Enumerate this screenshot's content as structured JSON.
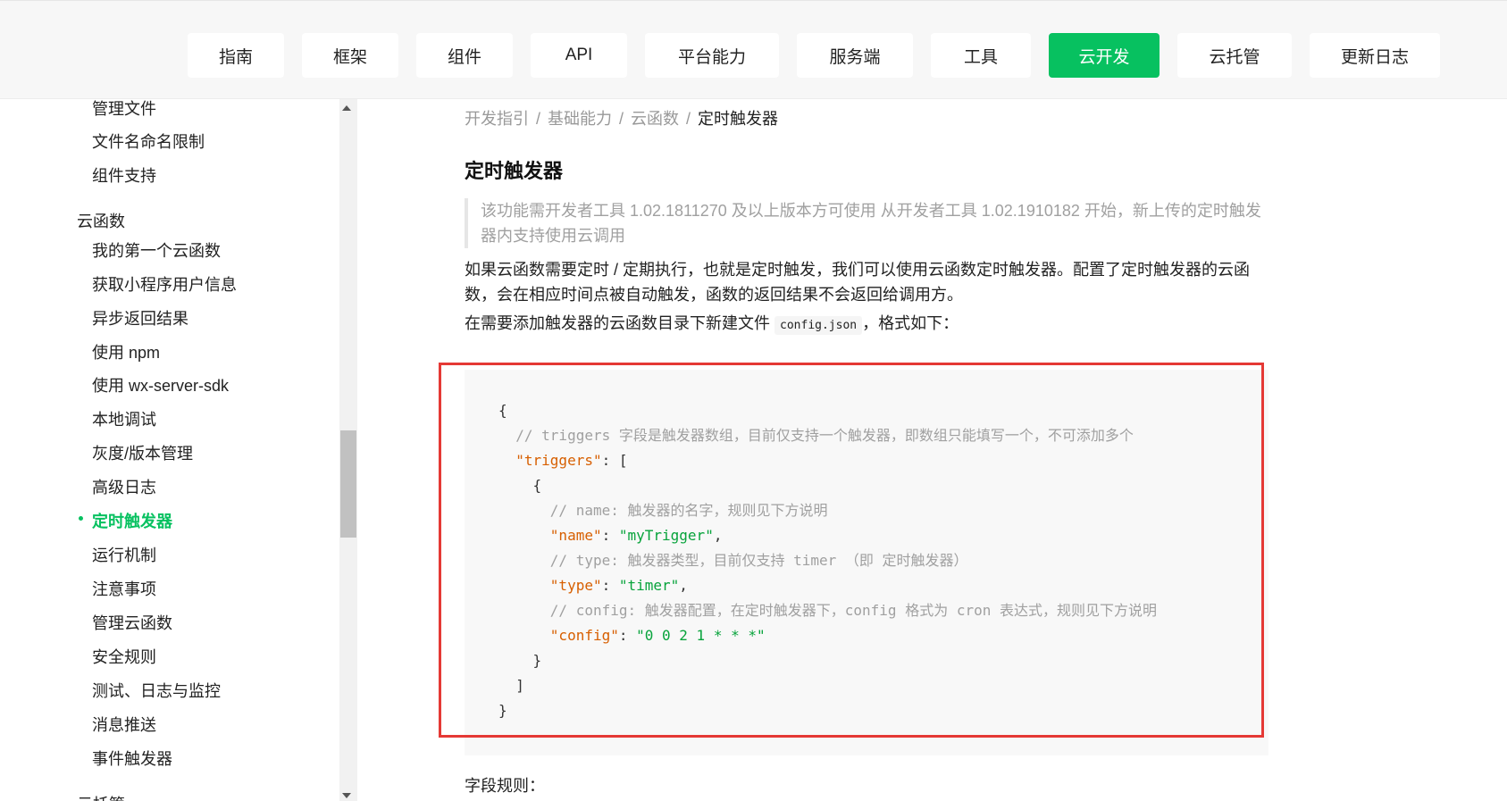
{
  "topnav": {
    "tabs": [
      {
        "label": "指南",
        "active": false
      },
      {
        "label": "框架",
        "active": false
      },
      {
        "label": "组件",
        "active": false
      },
      {
        "label": "API",
        "active": false
      },
      {
        "label": "平台能力",
        "active": false
      },
      {
        "label": "服务端",
        "active": false
      },
      {
        "label": "工具",
        "active": false
      },
      {
        "label": "云开发",
        "active": true
      },
      {
        "label": "云托管",
        "active": false
      },
      {
        "label": "更新日志",
        "active": false
      }
    ],
    "active_color": "#07c160"
  },
  "sidebar": {
    "items": [
      {
        "label": "管理文件",
        "level": "sub"
      },
      {
        "label": "文件名命名限制",
        "level": "sub"
      },
      {
        "label": "组件支持",
        "level": "sub"
      },
      {
        "label": "云函数",
        "level": "group"
      },
      {
        "label": "我的第一个云函数",
        "level": "sub"
      },
      {
        "label": "获取小程序用户信息",
        "level": "sub"
      },
      {
        "label": "异步返回结果",
        "level": "sub"
      },
      {
        "label": "使用 npm",
        "level": "sub"
      },
      {
        "label": "使用 wx-server-sdk",
        "level": "sub"
      },
      {
        "label": "本地调试",
        "level": "sub"
      },
      {
        "label": "灰度/版本管理",
        "level": "sub"
      },
      {
        "label": "高级日志",
        "level": "sub"
      },
      {
        "label": "定时触发器",
        "level": "sub",
        "active": true
      },
      {
        "label": "运行机制",
        "level": "sub"
      },
      {
        "label": "注意事项",
        "level": "sub"
      },
      {
        "label": "管理云函数",
        "level": "sub"
      },
      {
        "label": "安全规则",
        "level": "sub"
      },
      {
        "label": "测试、日志与监控",
        "level": "sub"
      },
      {
        "label": "消息推送",
        "level": "sub"
      },
      {
        "label": "事件触发器",
        "level": "sub"
      },
      {
        "label": "云托管",
        "level": "group"
      }
    ]
  },
  "content": {
    "breadcrumb": [
      "开发指引",
      "基础能力",
      "云函数",
      "定时触发器"
    ],
    "title": "定时触发器",
    "notice": "该功能需开发者工具 1.02.1811270 及以上版本方可使用 从开发者工具 1.02.1910182 开始，新上传的定时触发器内支持使用云调用",
    "paragraph1": "如果云函数需要定时 / 定期执行，也就是定时触发，我们可以使用云函数定时触发器。配置了定时触发器的云函数，会在相应时间点被自动触发，函数的返回结果不会返回给调用方。",
    "paragraph2_prefix": "在需要添加触发器的云函数目录下新建文件",
    "paragraph2_code": "config.json",
    "paragraph2_suffix": "，格式如下：",
    "code": {
      "open_brace": "{",
      "comment_triggers": "// triggers 字段是触发器数组，目前仅支持一个触发器，即数组只能填写一个，不可添加多个",
      "key_triggers": "\"triggers\"",
      "open_bracket": "[",
      "inner_open": "{",
      "comment_name": "// name: 触发器的名字，规则见下方说明",
      "key_name": "\"name\"",
      "val_name": "\"myTrigger\"",
      "comment_type": "// type: 触发器类型，目前仅支持 timer （即 定时触发器）",
      "key_type": "\"type\"",
      "val_type": "\"timer\"",
      "comment_config": "// config: 触发器配置，在定时触发器下，config 格式为 cron 表达式，规则见下方说明",
      "key_config": "\"config\"",
      "val_config": "\"0 0 2 1 * * *\"",
      "inner_close": "}",
      "close_bracket": "]",
      "close_brace": "}"
    },
    "field_rules": "字段规则："
  }
}
